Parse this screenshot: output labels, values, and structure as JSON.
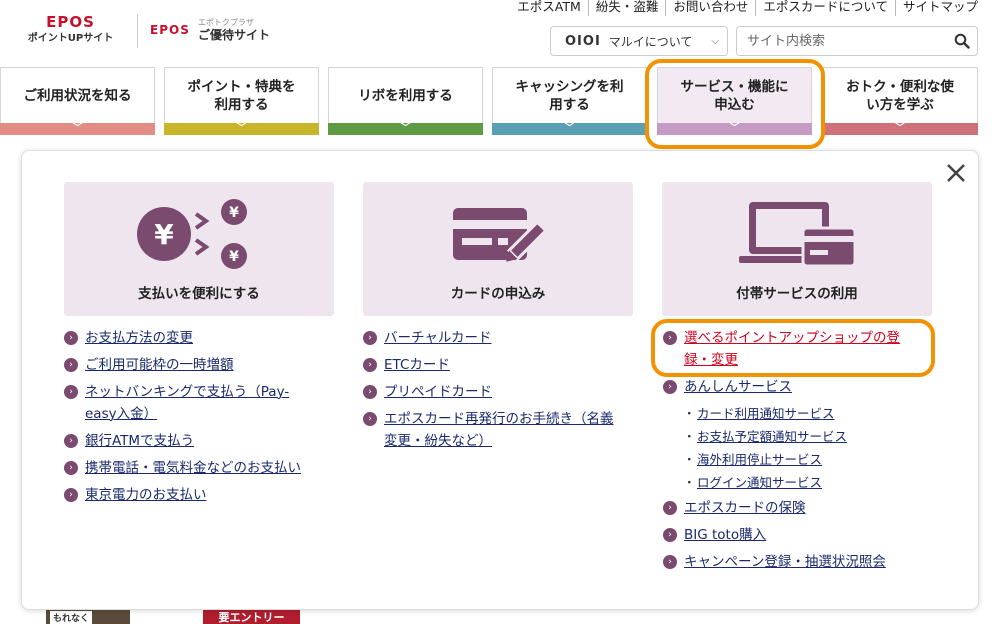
{
  "header": {
    "logo1": {
      "brand": "EPOS",
      "sub": "ポイントUPサイト"
    },
    "logo2": {
      "brand": "EPOS",
      "small": "エポトクプラザ",
      "big": "ご優待サイト"
    },
    "toplinks": [
      "エポスATM",
      "紛失・盗難",
      "お問い合わせ",
      "エポスカードについて",
      "サイトマップ"
    ],
    "marui": {
      "logo": "OIOI",
      "label": "マルイについて"
    },
    "search": {
      "placeholder": "サイト内検索"
    }
  },
  "nav": {
    "items": [
      {
        "label": "ご利用状況を知る",
        "color": "#e28d86"
      },
      {
        "label": "ポイント・特典を利用する",
        "color": "#c9b52a"
      },
      {
        "label": "リボを利用する",
        "color": "#5f9a44"
      },
      {
        "label": "キャッシングを利用する",
        "color": "#5a9fb3"
      },
      {
        "label": "サービス・機能に申込む",
        "color": "#c59bc3"
      },
      {
        "label": "おトク・便利な使い方を学ぶ",
        "color": "#d0707a"
      }
    ]
  },
  "panel": {
    "columns": [
      {
        "title": "支払いを便利にする",
        "icon": "yen-split-icon",
        "links": [
          "お支払方法の変更",
          "ご利用可能枠の一時増額",
          "ネットバンキングで支払う（Pay-easy入金）",
          "銀行ATMで支払う",
          "携帯電話・電気料金などのお支払い",
          "東京電力のお支払い"
        ]
      },
      {
        "title": "カードの申込み",
        "icon": "card-pen-icon",
        "links": [
          "バーチャルカード",
          "ETCカード",
          "プリペイドカード",
          "エポスカード再発行のお手続き（名義変更・紛失など）"
        ]
      },
      {
        "title": "付帯サービスの利用",
        "icon": "computer-card-icon",
        "highlight_link": "選べるポイントアップショップの登録・変更",
        "anshin": "あんしんサービス",
        "sublinks": [
          "カード利用通知サービス",
          "お支払予定額通知サービス",
          "海外利用停止サービス",
          "ログイン通知サービス"
        ],
        "links": [
          "エポスカードの保険",
          "BIG toto購入",
          "キャンペーン登録・抽選状況照会"
        ]
      }
    ]
  },
  "peek": {
    "badge": "もれなく",
    "entry": "要エントリー"
  },
  "colors": {
    "accent": "#7a4b6e",
    "highlight": "#f39200",
    "link": "#1a2a6c",
    "red_link": "#d0021b",
    "card_bg": "#efe5ef"
  }
}
